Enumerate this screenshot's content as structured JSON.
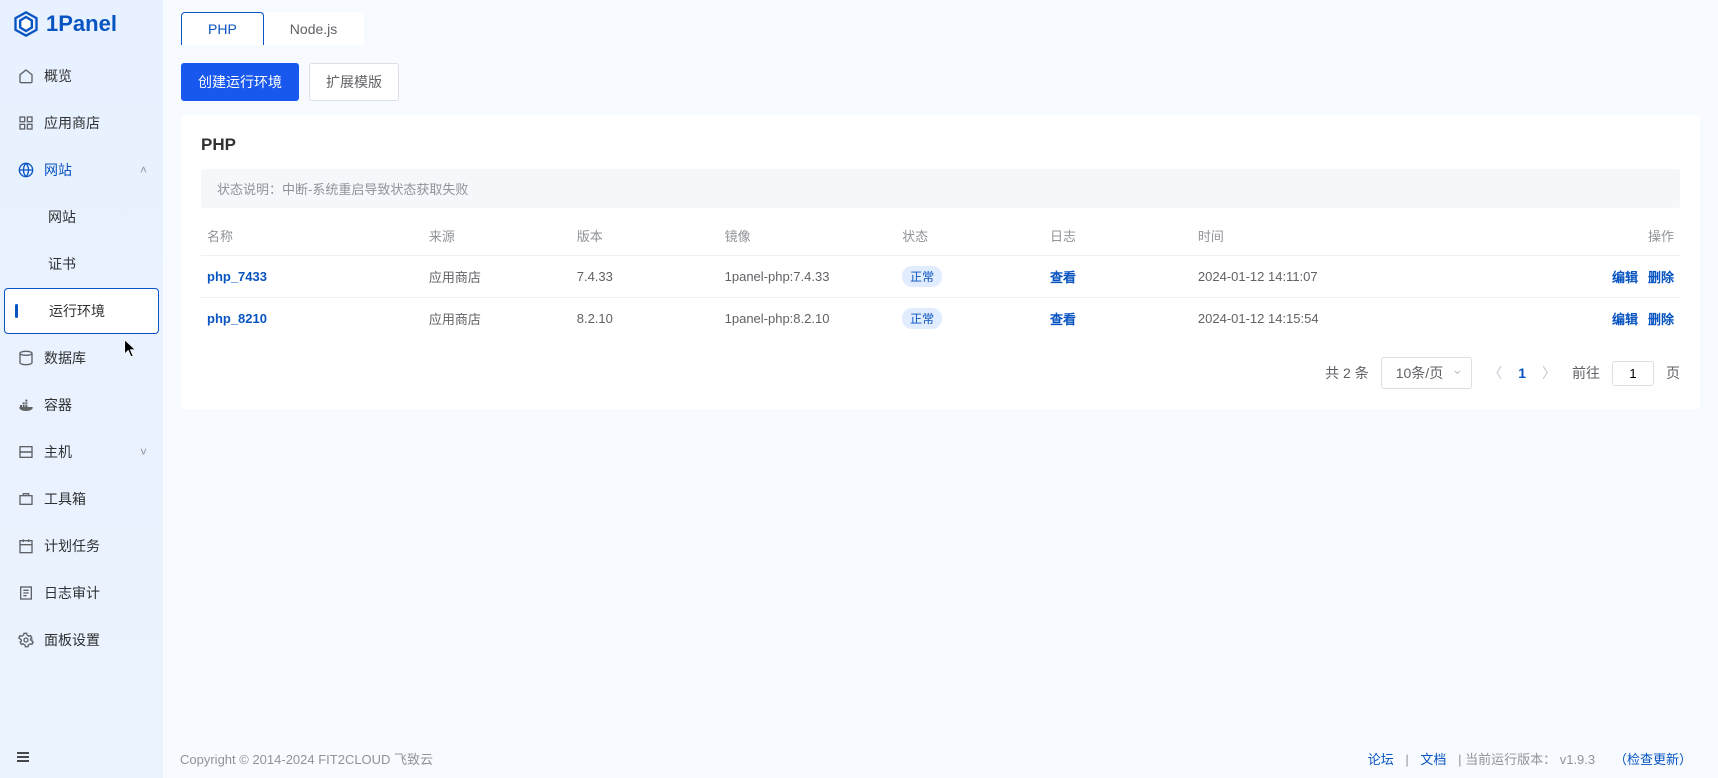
{
  "brand": "1Panel",
  "sidebar": {
    "items": [
      {
        "label": "概览"
      },
      {
        "label": "应用商店"
      },
      {
        "label": "网站"
      },
      {
        "label": "数据库"
      },
      {
        "label": "容器"
      },
      {
        "label": "主机"
      },
      {
        "label": "工具箱"
      },
      {
        "label": "计划任务"
      },
      {
        "label": "日志审计"
      },
      {
        "label": "面板设置"
      }
    ],
    "website_children": [
      {
        "label": "网站"
      },
      {
        "label": "证书"
      },
      {
        "label": "运行环境"
      }
    ]
  },
  "tabs": [
    {
      "label": "PHP"
    },
    {
      "label": "Node.js"
    }
  ],
  "toolbar": {
    "create": "创建运行环境",
    "ext": "扩展模版"
  },
  "card": {
    "title": "PHP",
    "alert": "状态说明：中断-系统重启导致状态获取失败"
  },
  "columns": {
    "name": "名称",
    "source": "来源",
    "version": "版本",
    "image": "镜像",
    "status": "状态",
    "log": "日志",
    "time": "时间",
    "ops": "操作"
  },
  "rows": [
    {
      "name": "php_7433",
      "source": "应用商店",
      "version": "7.4.33",
      "image": "1panel-php:7.4.33",
      "status": "正常",
      "log": "查看",
      "time": "2024-01-12 14:11:07"
    },
    {
      "name": "php_8210",
      "source": "应用商店",
      "version": "8.2.10",
      "image": "1panel-php:8.2.10",
      "status": "正常",
      "log": "查看",
      "time": "2024-01-12 14:15:54"
    }
  ],
  "row_ops": {
    "edit": "编辑",
    "del": "删除"
  },
  "pager": {
    "total": "共 2 条",
    "size": "10条/页",
    "current": "1",
    "goto_label": "前往",
    "goto_value": "1",
    "page_unit": "页"
  },
  "footer": {
    "copyright": "Copyright © 2014-2024 FIT2CLOUD 飞致云",
    "forum": "论坛",
    "docs": "文档",
    "sep": "|",
    "ver_label": "当前运行版本：",
    "ver": "v1.9.3",
    "check": "（检查更新）"
  }
}
